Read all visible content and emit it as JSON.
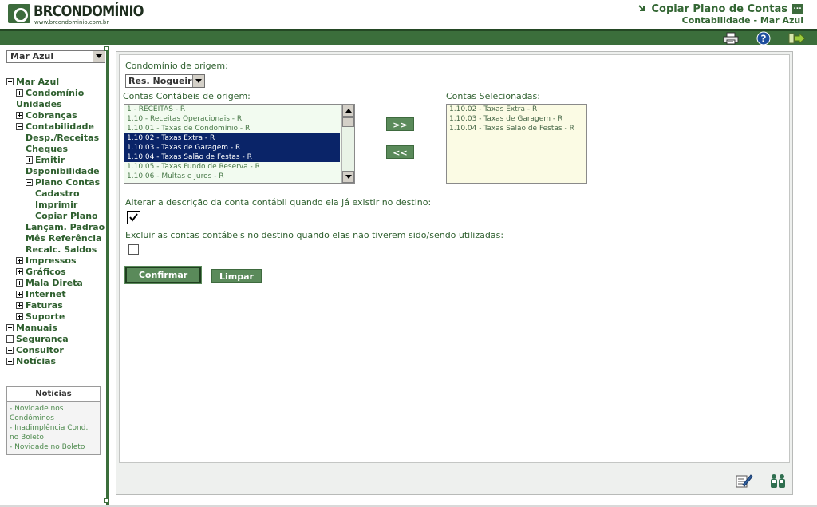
{
  "header": {
    "logo_text": "BRCONDOMÍNIO",
    "logo_sub": "www.brcondominio.com.br",
    "title": "Copiar Plano de Contas",
    "title_menu": "...",
    "subtitle": "Contabilidade - Mar Azul"
  },
  "toolbar": {
    "icons": [
      "printer-icon",
      "help-icon",
      "exit-icon"
    ],
    "colors": {
      "bar": "#3b6e3b",
      "accent": "#336633"
    }
  },
  "sidebar": {
    "selected_condo": "Mar Azul",
    "tree": [
      {
        "label": "Mar Azul",
        "level": 0,
        "toggle": "minus"
      },
      {
        "label": "Condomínio",
        "level": 1,
        "toggle": "plus"
      },
      {
        "label": "Unidades",
        "level": 1,
        "toggle": "none"
      },
      {
        "label": "Cobranças",
        "level": 1,
        "toggle": "plus"
      },
      {
        "label": "Contabilidade",
        "level": 1,
        "toggle": "minus"
      },
      {
        "label": "Desp./Receitas",
        "level": 2,
        "toggle": "none"
      },
      {
        "label": "Cheques",
        "level": 2,
        "toggle": "none"
      },
      {
        "label": "Emitir",
        "level": 2,
        "toggle": "plus"
      },
      {
        "label": "Dsponibilidade",
        "level": 2,
        "toggle": "none"
      },
      {
        "label": "Plano Contas",
        "level": 2,
        "toggle": "minus"
      },
      {
        "label": "Cadastro",
        "level": 3,
        "toggle": "none"
      },
      {
        "label": "Imprimir",
        "level": 3,
        "toggle": "none"
      },
      {
        "label": "Copiar Plano",
        "level": 3,
        "toggle": "none"
      },
      {
        "label": "Lançam. Padrão",
        "level": 2,
        "toggle": "none"
      },
      {
        "label": "Mês Referência",
        "level": 2,
        "toggle": "none"
      },
      {
        "label": "Recalc. Saldos",
        "level": 2,
        "toggle": "none"
      },
      {
        "label": "Impressos",
        "level": 1,
        "toggle": "plus"
      },
      {
        "label": "Gráficos",
        "level": 1,
        "toggle": "plus"
      },
      {
        "label": "Mala Direta",
        "level": 1,
        "toggle": "plus"
      },
      {
        "label": "Internet",
        "level": 1,
        "toggle": "plus"
      },
      {
        "label": "Faturas",
        "level": 1,
        "toggle": "plus"
      },
      {
        "label": "Suporte",
        "level": 1,
        "toggle": "plus"
      },
      {
        "label": "Manuais",
        "level": 0,
        "toggle": "plus"
      },
      {
        "label": "Segurança",
        "level": 0,
        "toggle": "plus"
      },
      {
        "label": "Consultor",
        "level": 0,
        "toggle": "plus"
      },
      {
        "label": "Notícias",
        "level": 0,
        "toggle": "plus"
      }
    ],
    "news": {
      "title": "Notícias",
      "items": [
        "- Novidade nos Condôminos",
        "- Inadimplência Cond. no Boleto",
        "- Novidade no Boleto"
      ]
    }
  },
  "form": {
    "origin_label": "Condomínio de origem:",
    "origin_value": "Res. Nogueira",
    "accounts_label": "Contas Contábeis de origem:",
    "accounts": [
      {
        "text": "1 - RECEITAS - R",
        "selected": false
      },
      {
        "text": "1.10 - Receitas Operacionais - R",
        "selected": false
      },
      {
        "text": "1.10.01 - Taxas de Condomínio - R",
        "selected": false
      },
      {
        "text": "1.10.02 - Taxas Extra - R",
        "selected": true
      },
      {
        "text": "1.10.03 - Taxas de Garagem - R",
        "selected": true
      },
      {
        "text": "1.10.04 - Taxas Salão de Festas - R",
        "selected": true
      },
      {
        "text": "1.10.05 - Taxas Fundo de Reserva - R",
        "selected": false
      },
      {
        "text": "1.10.06 - Multas e Juros - R",
        "selected": false
      }
    ],
    "add_label": ">>",
    "remove_label": "<<",
    "selected_label": "Contas Selecionadas:",
    "selected_accounts": [
      "1.10.02 - Taxas Extra - R",
      "1.10.03 - Taxas de Garagem - R",
      "1.10.04 - Taxas Salão de Festas - R"
    ],
    "option_alter_label": "Alterar a descrição da conta contábil quando ela já existir no destino:",
    "option_alter_checked": true,
    "option_delete_label": "Excluir as contas contábeis no destino quando elas não tiverem sido/sendo utilizadas:",
    "option_delete_checked": false,
    "confirm_label": "Confirmar",
    "clear_label": "Limpar"
  },
  "footer_icons": [
    "edit-checklist-icon",
    "users-icon"
  ]
}
